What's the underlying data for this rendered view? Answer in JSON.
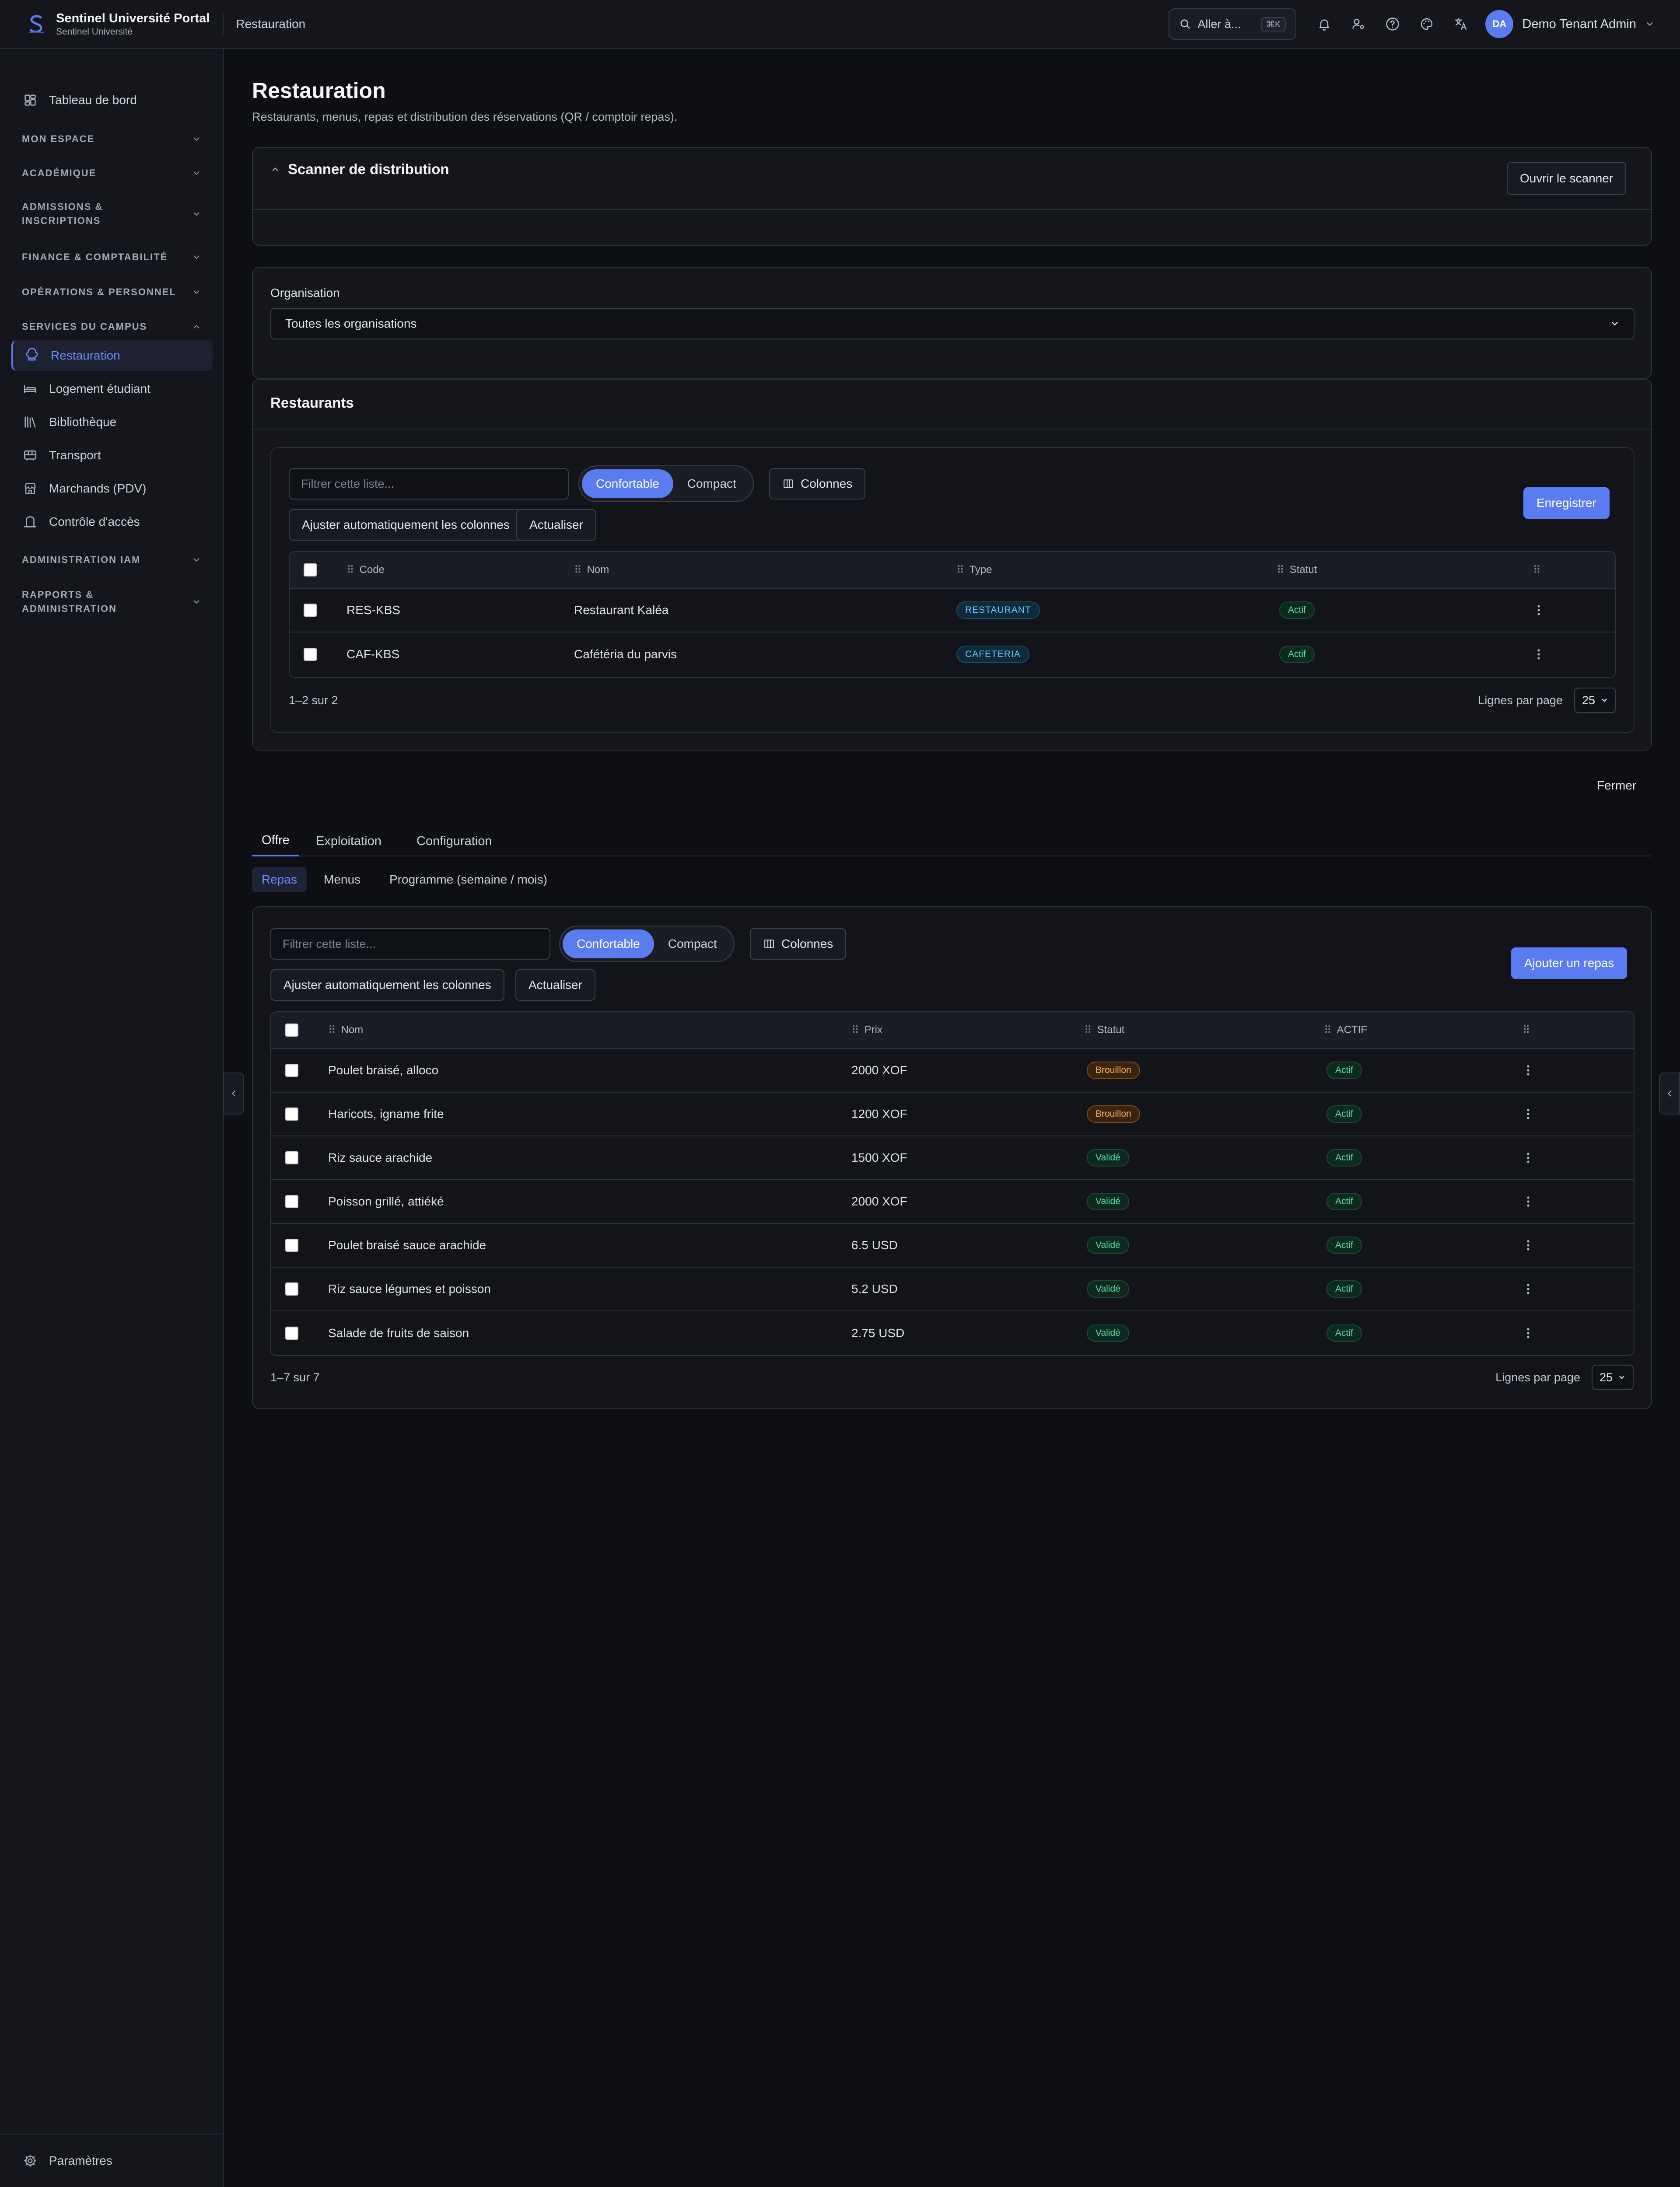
{
  "header": {
    "app_name": "Sentinel Université Portal",
    "app_subtitle": "Sentinel Université",
    "breadcrumb": "Restauration",
    "search_label": "Aller à...",
    "search_shortcut": "⌘K",
    "user_initials": "DA",
    "user_name": "Demo Tenant Admin"
  },
  "sidebar": {
    "dashboard": "Tableau de bord",
    "groups": {
      "mon_espace": "MON ESPACE",
      "academique": "ACADÉMIQUE",
      "admissions_1": "ADMISSIONS &",
      "admissions_2": "INSCRIPTIONS",
      "finance": "FINANCE & COMPTABILITÉ",
      "operations": "OPÉRATIONS & PERSONNEL",
      "services": "SERVICES DU CAMPUS",
      "iam": "ADMINISTRATION IAM",
      "rapports_1": "RAPPORTS &",
      "rapports_2": "ADMINISTRATION"
    },
    "items": [
      {
        "label": "Restauration",
        "icon": "chef-hat-icon"
      },
      {
        "label": "Logement étudiant",
        "icon": "bed-icon"
      },
      {
        "label": "Bibliothèque",
        "icon": "library-icon"
      },
      {
        "label": "Transport",
        "icon": "bus-icon"
      },
      {
        "label": "Marchands (PDV)",
        "icon": "store-icon"
      },
      {
        "label": "Contrôle d'accès",
        "icon": "lock-icon"
      }
    ],
    "settings": "Paramètres"
  },
  "page": {
    "title": "Restauration",
    "subtitle": "Restaurants, menus, repas et distribution des réservations (QR / comptoir repas)."
  },
  "scanner": {
    "title": "Scanner de distribution",
    "open_button": "Ouvrir le scanner"
  },
  "organisation": {
    "label": "Organisation",
    "selected": "Toutes les organisations"
  },
  "restaurants": {
    "title": "Restaurants",
    "filter_placeholder": "Filtrer cette liste...",
    "density_comfortable": "Confortable",
    "density_compact": "Compact",
    "columns_button": "Colonnes",
    "autofit_button": "Ajuster automatiquement les colonnes",
    "refresh_button": "Actualiser",
    "save_button": "Enregistrer",
    "columns": {
      "code": "Code",
      "name": "Nom",
      "type": "Type",
      "status": "Statut"
    },
    "rows": [
      {
        "code": "RES-KBS",
        "name": "Restaurant Kaléa",
        "type": "RESTAURANT",
        "status": "Actif"
      },
      {
        "code": "CAF-KBS",
        "name": "Cafétéria du parvis",
        "type": "CAFETERIA",
        "status": "Actif"
      }
    ],
    "range": "1–2 sur 2",
    "rows_per_page_label": "Lignes par page",
    "rows_per_page": "25"
  },
  "close_label": "Fermer",
  "tabs": [
    "Offre",
    "Exploitation",
    "Configuration"
  ],
  "subtabs": [
    "Repas",
    "Menus",
    "Programme (semaine / mois)"
  ],
  "meals": {
    "filter_placeholder": "Filtrer cette liste...",
    "density_comfortable": "Confortable",
    "density_compact": "Compact",
    "columns_button": "Colonnes",
    "autofit_button": "Ajuster automatiquement les colonnes",
    "refresh_button": "Actualiser",
    "add_button": "Ajouter un repas",
    "columns": {
      "name": "Nom",
      "price": "Prix",
      "status": "Statut",
      "active": "ACTIF"
    },
    "rows": [
      {
        "name": "Poulet braisé, alloco",
        "price": "2000 XOF",
        "status": "Brouillon",
        "active": "Actif"
      },
      {
        "name": "Haricots, igname frite",
        "price": "1200 XOF",
        "status": "Brouillon",
        "active": "Actif"
      },
      {
        "name": "Riz sauce arachide",
        "price": "1500 XOF",
        "status": "Validé",
        "active": "Actif"
      },
      {
        "name": "Poisson grillé, attiéké",
        "price": "2000 XOF",
        "status": "Validé",
        "active": "Actif"
      },
      {
        "name": "Poulet braisé sauce arachide",
        "price": "6.5 USD",
        "status": "Validé",
        "active": "Actif"
      },
      {
        "name": "Riz sauce légumes et poisson",
        "price": "5.2 USD",
        "status": "Validé",
        "active": "Actif"
      },
      {
        "name": "Salade de fruits de saison",
        "price": "2.75 USD",
        "status": "Validé",
        "active": "Actif"
      }
    ],
    "range": "1–7 sur 7",
    "rows_per_page_label": "Lignes par page",
    "rows_per_page": "25"
  },
  "colors": {
    "accent": "#5b7cf0",
    "background": "#0e0f13",
    "status_active": "#5fe0a6",
    "status_draft": "#ffb25c",
    "type_badge": "#6ac8ff"
  }
}
